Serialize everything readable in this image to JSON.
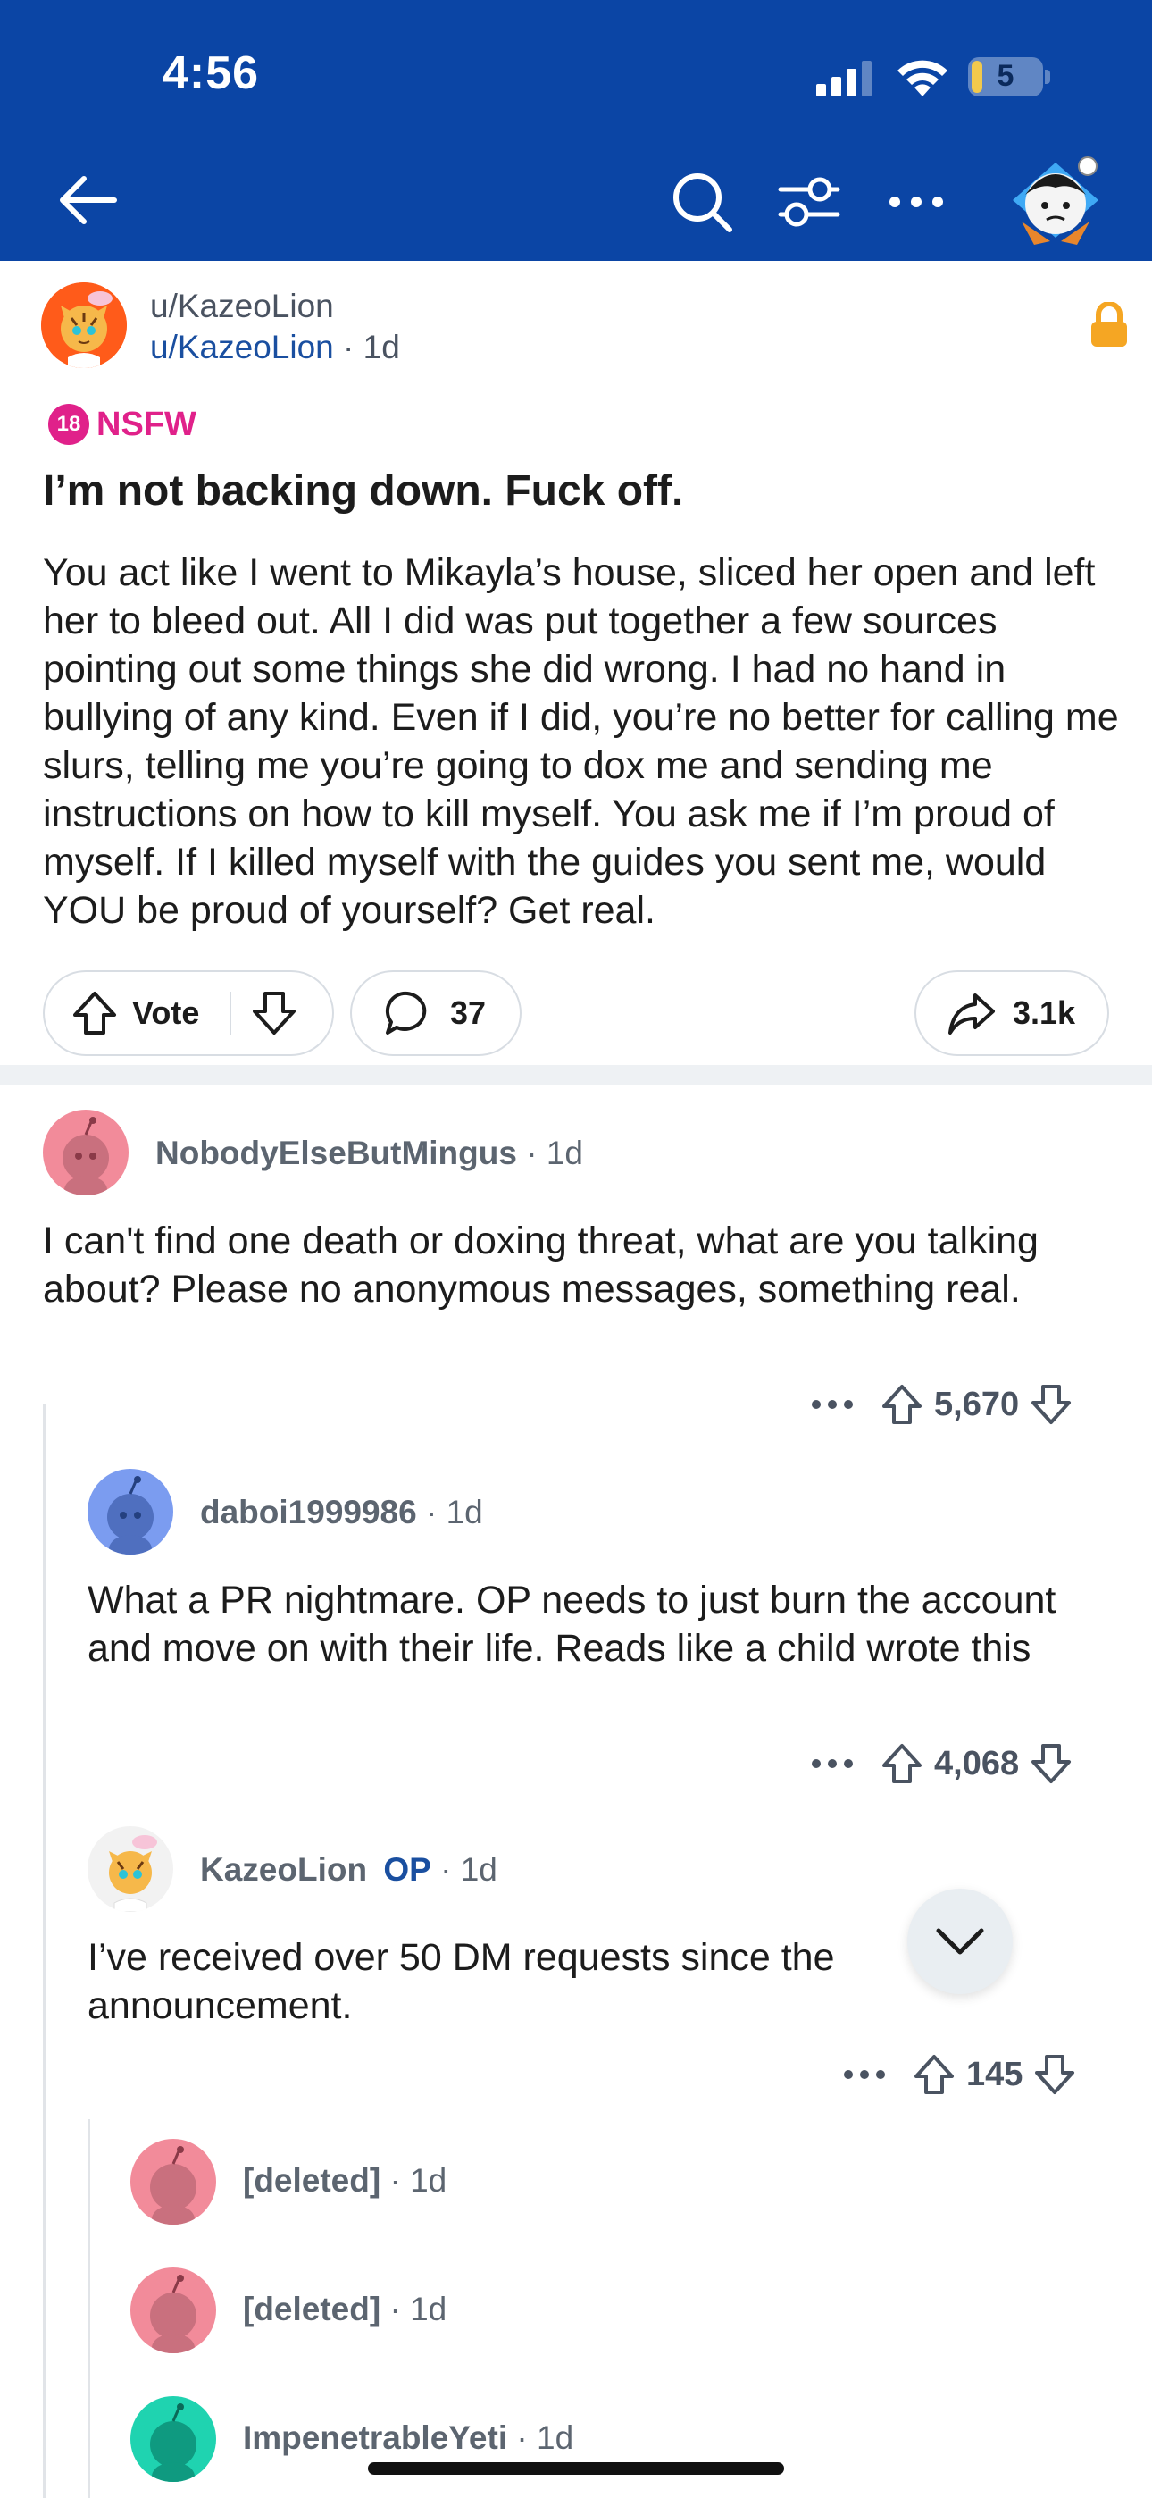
{
  "status_bar": {
    "time": "4:56",
    "battery": "5"
  },
  "nav": {
    "back_icon": "arrow-left-icon",
    "search_icon": "search-icon",
    "filter_icon": "sort-filter-icon",
    "more_icon": "more-horizontal-icon"
  },
  "post": {
    "community": "u/KazeoLion",
    "author": "u/KazeoLion",
    "age": "1d",
    "nsfw_badge": "18",
    "nsfw_label": "NSFW",
    "title": "I’m not backing down. Fuck off.",
    "body": "You act like I went to Mikayla’s house, sliced her open and left her to bleed out. All I did was put together a few sources pointing out some things she did wrong. I had no hand in bullying of any kind. Even if I did, you’re no better for calling me slurs, telling me you’re going to dox me and sending me instructions on how to kill myself. You ask me if I’m proud of myself. If I killed myself with the guides you sent me, would YOU be proud of yourself? Get real.",
    "vote_label": "Vote",
    "comment_count": "37",
    "share_count": "3.1k"
  },
  "comments": [
    {
      "name": "NobodyElseButMingus",
      "age": "1d",
      "body": "I can't find one death or doxing threat, what are you talking about? Please no anonymous messages, something real.",
      "score": "5,670"
    },
    {
      "name": "daboi1999986",
      "age": "1d",
      "body": "What a PR nightmare. OP needs to just burn the account and move on with their life. Reads like a child wrote this",
      "score": "4,068"
    },
    {
      "name": "KazeoLion",
      "op_label": "OP",
      "age": "1d",
      "body": "I’ve received over 50 DM requests since the announcement.",
      "score": "145"
    },
    {
      "name": "[deleted]",
      "age": "1d"
    },
    {
      "name": "[deleted]",
      "age": "1d"
    },
    {
      "name": "ImpenetrableYeti",
      "age": "1d"
    }
  ],
  "separator": "·",
  "colors": {
    "header": "#0b45a5",
    "nsfw": "#e0218a",
    "op": "#1a4fa0",
    "avatar_pink": "#f28b9a",
    "avatar_blue": "#7b9cf0",
    "avatar_teal": "#1fd3b0"
  }
}
